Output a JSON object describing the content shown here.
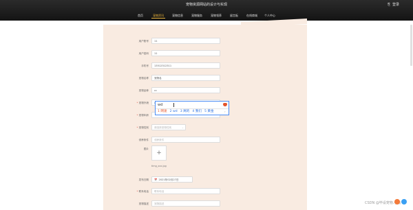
{
  "header": {
    "site_title": "宠物资源网站的设计与实现",
    "login_icon": "⎘",
    "login_label": "登录",
    "nav": [
      {
        "label": "首页",
        "active": false
      },
      {
        "label": "宠物资讯",
        "active": true
      },
      {
        "label": "宠物信息",
        "active": false
      },
      {
        "label": "宠物服务",
        "active": false
      },
      {
        "label": "宠物领养",
        "active": false
      },
      {
        "label": "留言板",
        "active": false
      },
      {
        "label": "在线商城",
        "active": false
      },
      {
        "label": "个人中心",
        "active": false
      }
    ]
  },
  "form": {
    "fields": [
      {
        "label": "用户账号",
        "required": false,
        "value": "11",
        "placeholder": false
      },
      {
        "label": "用户密码",
        "required": false,
        "value": "11",
        "placeholder": false
      },
      {
        "label": "手机号",
        "required": false,
        "value": "13512312311",
        "placeholder": false
      },
      {
        "label": "宠物名称",
        "required": false,
        "value": "宠物名",
        "placeholder": false
      },
      {
        "label": "宠物品种",
        "required": false,
        "value": "cc",
        "placeholder": false
      },
      {
        "label": "宠物外貌",
        "required": true,
        "value": "wd",
        "placeholder": false
      },
      {
        "label": "宠物年龄",
        "required": true,
        "value": "",
        "placeholder": false
      },
      {
        "label": "宠物性别",
        "required": true,
        "value": "请选择宠物性别",
        "placeholder": true
      },
      {
        "label": "领养条件",
        "required": false,
        "value": "领养条件",
        "placeholder": true
      }
    ],
    "image_label": "图片",
    "upload_plus": "+",
    "upload_filename": "timg_xxx.jpg",
    "date_label": "发布日期",
    "date_icon": "📅",
    "date_value": "2021年02月27日",
    "contact_label": "联系电话",
    "contact_required": true,
    "contact_placeholder": "联系电话",
    "more_label": "宠物描述",
    "more_placeholder": "宠物描述"
  },
  "ime": {
    "composing": "wd",
    "candidates": [
      "1 网速",
      "2 wd",
      "3 窝的",
      "4 我们",
      "5 黄金"
    ],
    "more": "›"
  },
  "watermark": "CSDN @毕设宠物.小熊",
  "colors": {
    "accent": "#e8b23a",
    "panel": "#f9ebe1",
    "header_bg": "#1c1c1c",
    "ime_border": "#4a8cf5",
    "ime_candidate": "#2a6fe0",
    "ime_first": "#e4532a"
  }
}
